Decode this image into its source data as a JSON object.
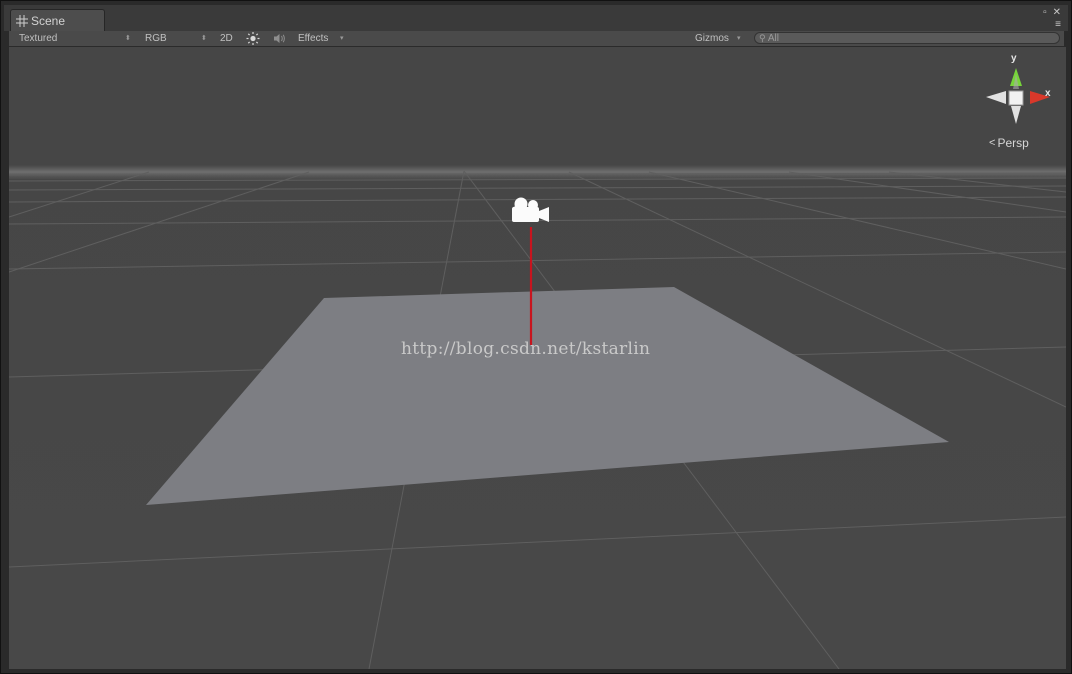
{
  "window": {
    "tab_title": "Scene",
    "tab_icon": "grid-icon",
    "controls": {
      "maximize": "▫",
      "close": "✕",
      "menu": "≡"
    }
  },
  "toolbar": {
    "render_mode": "Textured",
    "channel": "RGB",
    "mode_2d": "2D",
    "lighting_icon": "sun-icon",
    "audio_icon": "speaker-icon",
    "effects": "Effects",
    "gizmos": "Gizmos",
    "search_placeholder": "All",
    "search_icon": "search-icon"
  },
  "scene": {
    "watermark": "http://blog.csdn.net/kstarlin",
    "projection_label": "Persp",
    "axis_labels": {
      "y": "y",
      "x": "x"
    },
    "colors": {
      "background": "#474747",
      "plane": "#7d7e82",
      "grid": "#5c5c5c",
      "horizon": "#6a6a6a",
      "camera_line": "#c8141e",
      "gizmo_y": "#77d43a",
      "gizmo_x": "#d9382a"
    }
  }
}
